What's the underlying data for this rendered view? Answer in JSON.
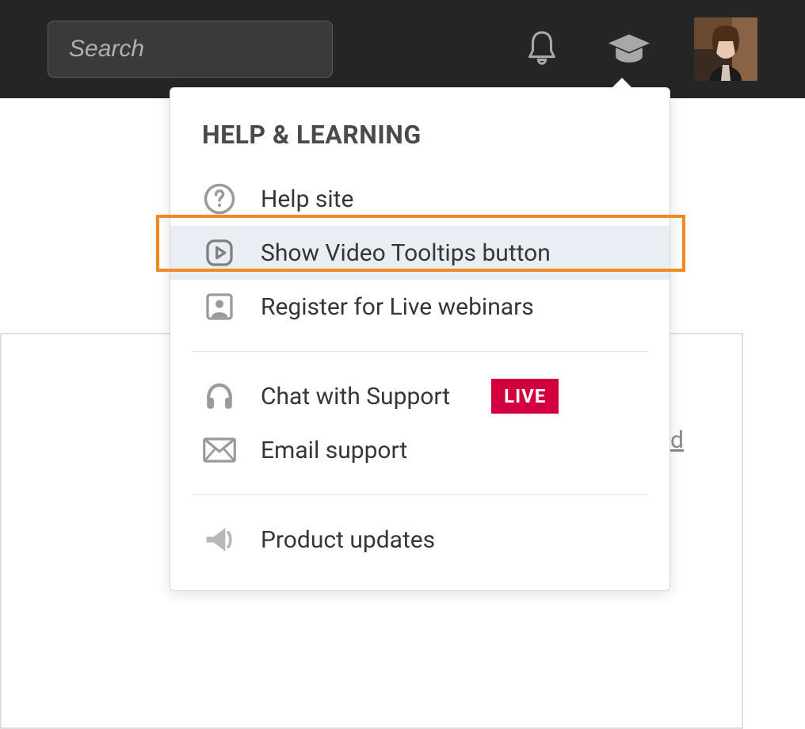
{
  "header": {
    "search_placeholder": "Search"
  },
  "dropdown": {
    "title": "HELP & LEARNING",
    "items": {
      "help_site": "Help site",
      "video_tooltips": "Show Video Tooltips button",
      "webinars": "Register for Live webinars",
      "chat": "Chat with Support",
      "live_badge": "LIVE",
      "email": "Email support",
      "updates": "Product updates"
    }
  },
  "background": {
    "partial_link": "d"
  }
}
